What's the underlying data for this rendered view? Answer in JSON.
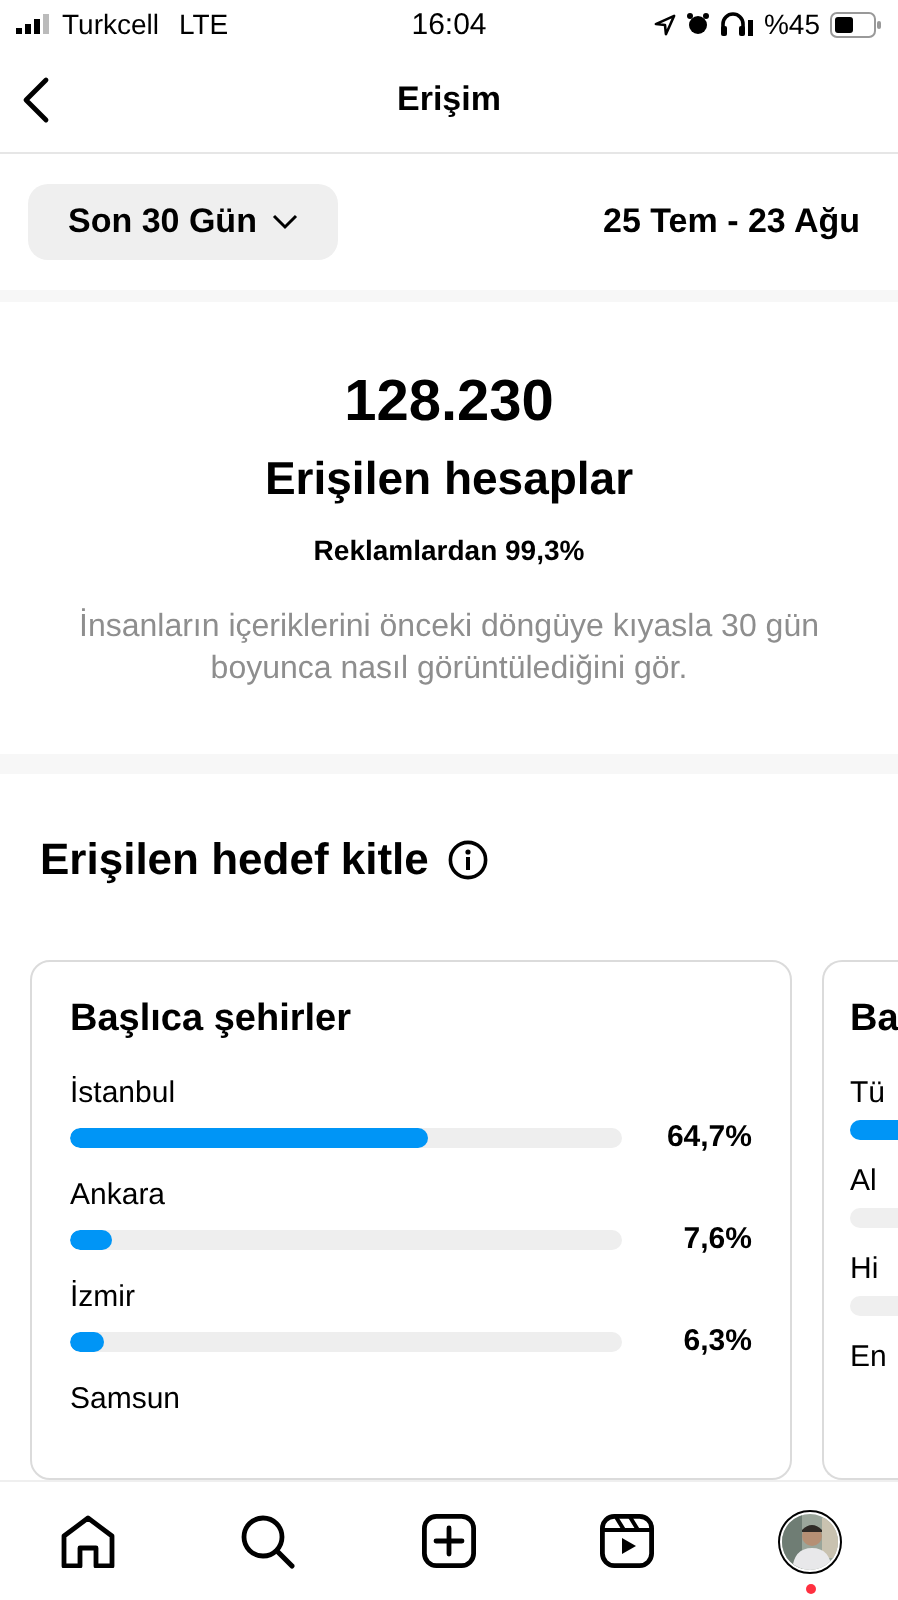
{
  "status_bar": {
    "carrier": "Turkcell",
    "network": "LTE",
    "time": "16:04",
    "battery": "%45"
  },
  "header": {
    "title": "Erişim"
  },
  "filter": {
    "period": "Son 30 Gün",
    "date_range": "25 Tem - 23 Ağu"
  },
  "summary": {
    "value": "128.230",
    "label": "Erişilen hesaplar",
    "ads": "Reklamlardan 99,3%",
    "description": "İnsanların içeriklerini önceki döngüye kıyasla 30 gün boyunca nasıl görüntülediğini gör."
  },
  "audience": {
    "title": "Erişilen hedef kitle",
    "cards": [
      {
        "title": "Başlıca şehirler",
        "rows": [
          {
            "label": "İstanbul",
            "level": 0.647,
            "reading": "64,7%"
          },
          {
            "label": "Ankara",
            "level": 0.076,
            "reading": "7,6%"
          },
          {
            "label": "İzmir",
            "level": 0.063,
            "reading": "6,3%"
          },
          {
            "label": "Samsun"
          }
        ]
      },
      {
        "title": "Ba",
        "rows": [
          {
            "label": "Tü",
            "color": "#0095f6"
          },
          {
            "label": "Al",
            "color": "#efefef"
          },
          {
            "label": "Hi",
            "color": "#efefef"
          },
          {
            "label": "En"
          }
        ]
      }
    ]
  },
  "tab_bar": {
    "items": [
      {
        "kind": "home",
        "selected": false
      },
      {
        "kind": "search",
        "selected": false
      },
      {
        "kind": "create",
        "selected": false
      },
      {
        "kind": "reels",
        "selected": false
      },
      {
        "kind": "profile",
        "selected": true,
        "notification": true
      }
    ]
  }
}
